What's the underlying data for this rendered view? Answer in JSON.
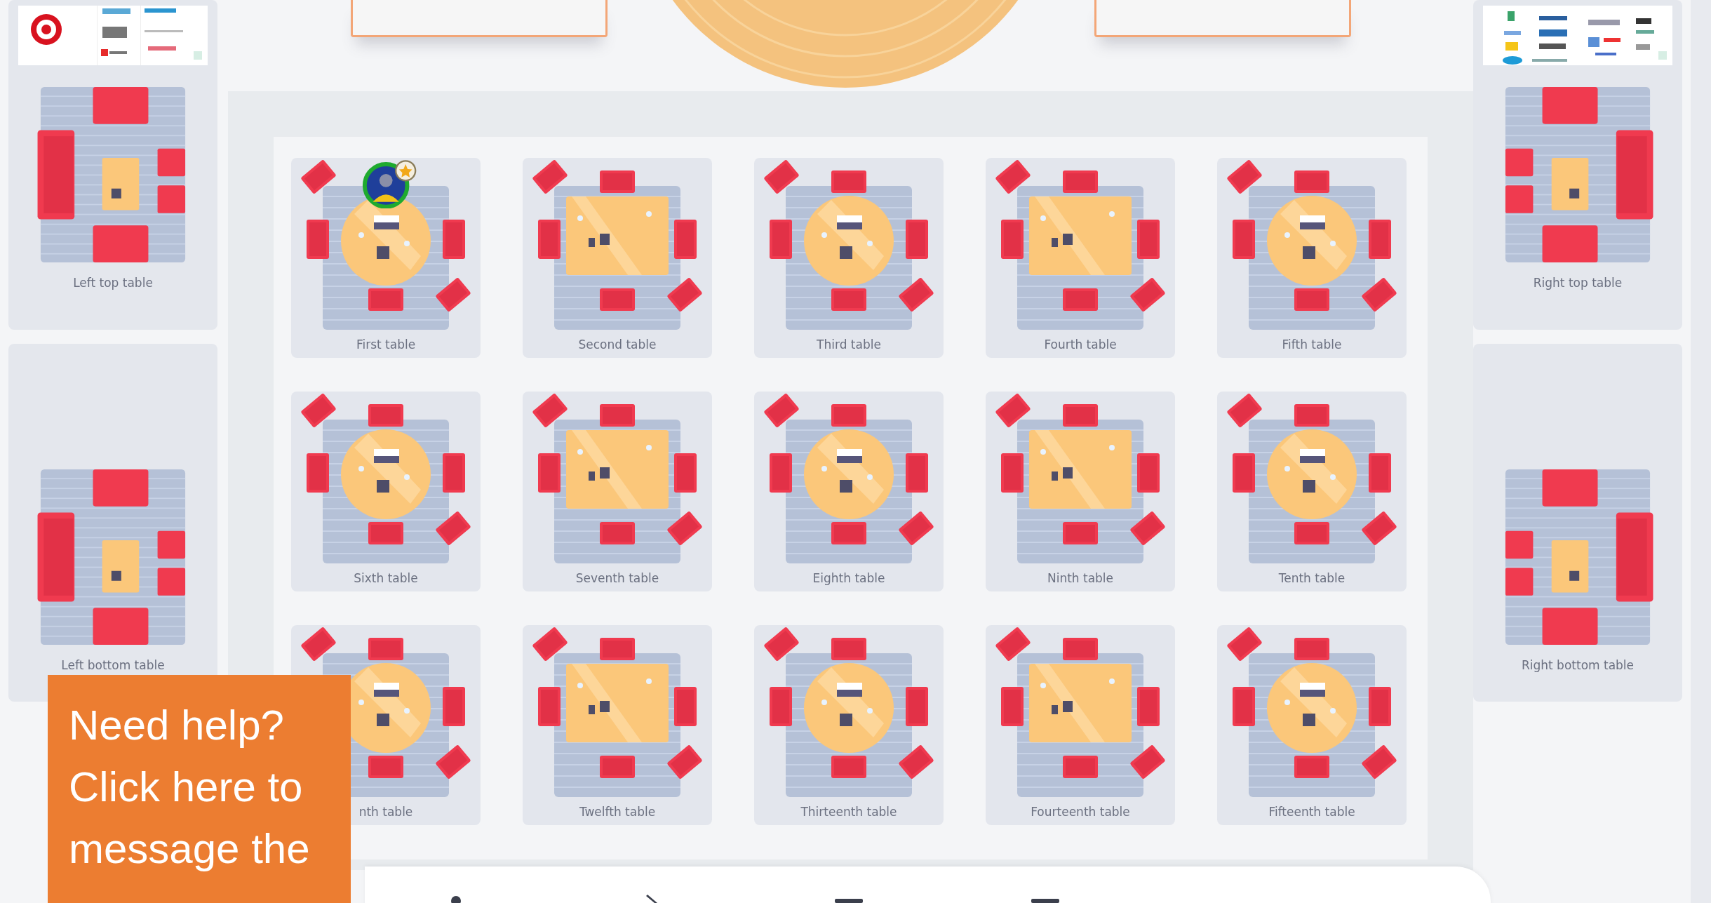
{
  "lounges": [
    {
      "label": "Left top table",
      "mirrored": false,
      "sponsor_wall": true
    },
    {
      "label": "Left bottom table",
      "mirrored": false,
      "sponsor_wall": false
    },
    {
      "label": "Right top table",
      "mirrored": true,
      "sponsor_wall": true
    },
    {
      "label": "Right bottom table",
      "mirrored": true,
      "sponsor_wall": false
    }
  ],
  "tables": [
    {
      "label": "First table",
      "kind": "round",
      "attendee": true
    },
    {
      "label": "Second table",
      "kind": "square",
      "attendee": false
    },
    {
      "label": "Third table",
      "kind": "round",
      "attendee": false
    },
    {
      "label": "Fourth table",
      "kind": "square",
      "attendee": false
    },
    {
      "label": "Fifth table",
      "kind": "round",
      "attendee": false
    },
    {
      "label": "Sixth table",
      "kind": "round",
      "attendee": false
    },
    {
      "label": "Seventh table",
      "kind": "square",
      "attendee": false
    },
    {
      "label": "Eighth table",
      "kind": "round",
      "attendee": false
    },
    {
      "label": "Ninth table",
      "kind": "square",
      "attendee": false
    },
    {
      "label": "Tenth table",
      "kind": "round",
      "attendee": false
    },
    {
      "label": "nth table",
      "kind": "round",
      "attendee": false
    },
    {
      "label": "Twelfth table",
      "kind": "square",
      "attendee": false
    },
    {
      "label": "Thirteenth table",
      "kind": "round",
      "attendee": false
    },
    {
      "label": "Fourteenth table",
      "kind": "square",
      "attendee": false
    },
    {
      "label": "Fifteenth table",
      "kind": "round",
      "attendee": false
    }
  ],
  "help_box": {
    "text": "Need help? Click here to message the"
  }
}
